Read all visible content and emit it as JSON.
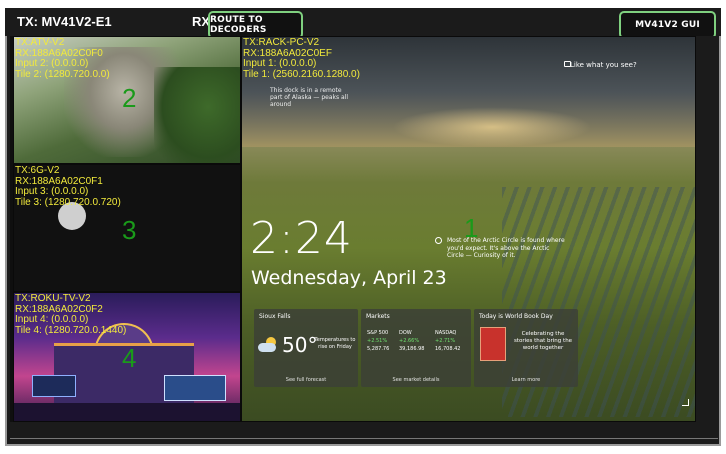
{
  "header": {
    "tx_label": "TX:  MV41V2-E1",
    "rx_label": "RX:",
    "route_button": "ROUTE TO DECODERS",
    "gui_button": "MV41V2 GUI"
  },
  "tiles": [
    {
      "id": "tile-1",
      "number": "1",
      "tx": "TX:RACK-PC-V2",
      "rx": "RX:188A6A02C0EF",
      "input": "Input 1: (0.0.0.0)",
      "tile": "Tile 1: (2560.2160.1280.0)"
    },
    {
      "id": "tile-2",
      "number": "2",
      "tx": "TX:ATV-V2",
      "rx": "RX:188A6A02C0F0",
      "input": "Input 2: (0.0.0.0)",
      "tile": "Tile 2: (1280.720.0.0)"
    },
    {
      "id": "tile-3",
      "number": "3",
      "tx": "TX:6G-V2",
      "rx": "RX:188A6A02C0F1",
      "input": "Input 3: (0.0.0.0)",
      "tile": "Tile 3: (1280.720.0.720)"
    },
    {
      "id": "tile-4",
      "number": "4",
      "tx": "TX:ROKU-TV-V2",
      "rx": "RX:188A6A02C0F2",
      "input": "Input 4: (0.0.0.0)",
      "tile": "Tile 4: (1280.720.0.1440)"
    }
  ],
  "lockscreen": {
    "time": "2:24",
    "date": "Wednesday, April 23",
    "like_what": "Like what you see?",
    "caption_top": "This dock is in a remote part of Alaska — peaks all around",
    "fact": "Most of the Arctic Circle is found where you'd expect. It's above the Arctic Circle — Curiosity of it.",
    "weather": {
      "location": "Sioux Falls",
      "temp": "50°",
      "desc": "Temperatures to rise on Friday",
      "footer": "See full forecast"
    },
    "markets": {
      "title": "Markets",
      "items": [
        {
          "name": "S&P 500",
          "change": "+2.51%",
          "value": "5,287.76"
        },
        {
          "name": "DOW",
          "change": "+2.66%",
          "value": "39,186.98"
        },
        {
          "name": "NASDAQ",
          "change": "+2.71%",
          "value": "16,708.42"
        }
      ],
      "footer": "See market details"
    },
    "book": {
      "title": "Today is World Book Day",
      "text": "Celebrating the stories that bring the world together",
      "footer": "Learn more"
    }
  }
}
